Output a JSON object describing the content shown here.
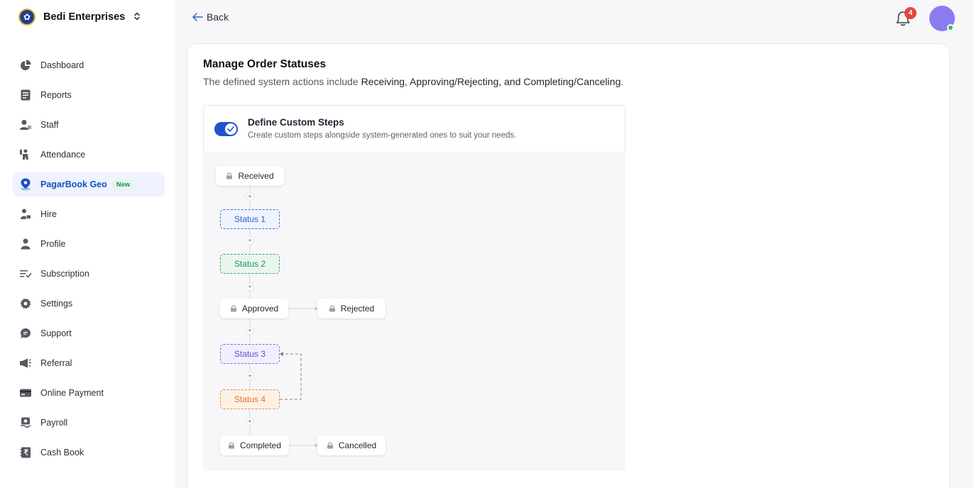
{
  "org": {
    "name": "Bedi Enterprises"
  },
  "sidebar": {
    "items": [
      {
        "label": "Dashboard",
        "icon": "pie-chart-icon"
      },
      {
        "label": "Reports",
        "icon": "report-icon"
      },
      {
        "label": "Staff",
        "icon": "staff-icon"
      },
      {
        "label": "Attendance",
        "icon": "attendance-icon"
      },
      {
        "label": "PagarBook Geo",
        "icon": "location-pin-icon",
        "badge": "New",
        "active": true
      },
      {
        "label": "Hire",
        "icon": "hire-icon"
      },
      {
        "label": "Profile",
        "icon": "profile-icon"
      },
      {
        "label": "Subscription",
        "icon": "subscription-icon"
      },
      {
        "label": "Settings",
        "icon": "gear-icon"
      },
      {
        "label": "Support",
        "icon": "chat-icon"
      },
      {
        "label": "Referral",
        "icon": "megaphone-icon"
      },
      {
        "label": "Online Payment",
        "icon": "card-icon"
      },
      {
        "label": "Payroll",
        "icon": "payroll-icon"
      },
      {
        "label": "Cash Book",
        "icon": "cash-book-icon"
      }
    ]
  },
  "topbar": {
    "back_label": "Back",
    "notification_count": "4"
  },
  "page": {
    "title": "Manage Order Statuses",
    "subtitle_prefix": "The defined system actions include ",
    "subtitle_actions": "Receiving, Approving/Rejecting, and Completing/Canceling",
    "subtitle_suffix": "."
  },
  "custom_steps": {
    "title": "Define Custom Steps",
    "description": "Create custom steps alongside system-generated ones to suit your needs.",
    "enabled": true
  },
  "flow": {
    "received": "Received",
    "status1": "Status 1",
    "status2": "Status 2",
    "approved": "Approved",
    "rejected": "Rejected",
    "status3": "Status 3",
    "status4": "Status 4",
    "completed": "Completed",
    "cancelled": "Cancelled",
    "plus": "+"
  },
  "colors": {
    "accent": "#1c55cf",
    "status1": "#2c62cf",
    "status2": "#2a8f52",
    "status3": "#6a4ccf",
    "status4": "#e17426",
    "notification": "#e4453b",
    "avatar": "#8b7cf2"
  }
}
